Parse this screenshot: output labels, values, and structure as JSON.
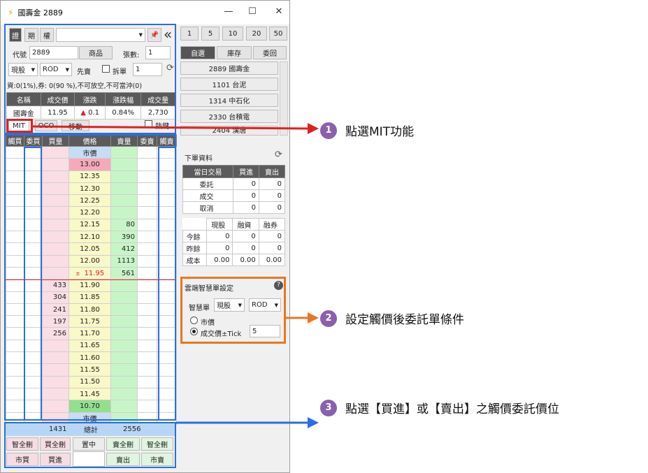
{
  "window": {
    "title": "國壽金 2889"
  },
  "top": {
    "tabs": [
      "證",
      "期",
      "權"
    ],
    "code_label": "代號",
    "code": "2889",
    "product_btn": "商品",
    "qty_label": "張數:",
    "qty": "1",
    "type": "現股",
    "cond": "ROD",
    "presell": "先賣",
    "split": "拆單",
    "split_qty": "1",
    "info": "資:0(1%),券: 0(90 %),不可放空,不可當沖(0)"
  },
  "quote": {
    "headers": [
      "名稱",
      "成交價",
      "漲跌",
      "漲跌幅",
      "成交量"
    ],
    "name": "國壽金",
    "price": "11.95",
    "change_icon": "▲",
    "change": "0.1",
    "pct": "0.84%",
    "vol": "2,730"
  },
  "modes": {
    "mit": "MIT",
    "oco": "OCO",
    "move": "移動",
    "hotkey": "熱鍵"
  },
  "ladder": {
    "headers": [
      "觸買",
      "委買",
      "買量",
      "價格",
      "賣量",
      "委賣",
      "觸賣"
    ],
    "rows": [
      {
        "bid": "",
        "price": "市價",
        "ask": "",
        "pc": "mkt"
      },
      {
        "bid": "",
        "price": "13.00",
        "ask": "",
        "pc": "lim"
      },
      {
        "bid": "",
        "price": "12.35",
        "ask": ""
      },
      {
        "bid": "",
        "price": "12.30",
        "ask": ""
      },
      {
        "bid": "",
        "price": "12.25",
        "ask": ""
      },
      {
        "bid": "",
        "price": "12.20",
        "ask": ""
      },
      {
        "bid": "",
        "price": "12.15",
        "ask": "80"
      },
      {
        "bid": "",
        "price": "12.10",
        "ask": "390"
      },
      {
        "bid": "",
        "price": "12.05",
        "ask": "412"
      },
      {
        "bid": "",
        "price": "12.00",
        "ask": "1113"
      },
      {
        "bid": "",
        "price": "11.95",
        "ask": "561",
        "pc": "last",
        "mark": "±"
      },
      {
        "bid": "433",
        "price": "11.90",
        "ask": ""
      },
      {
        "bid": "304",
        "price": "11.85",
        "ask": ""
      },
      {
        "bid": "241",
        "price": "11.80",
        "ask": ""
      },
      {
        "bid": "197",
        "price": "11.75",
        "ask": ""
      },
      {
        "bid": "256",
        "price": "11.70",
        "ask": ""
      },
      {
        "bid": "",
        "price": "11.65",
        "ask": ""
      },
      {
        "bid": "",
        "price": "11.60",
        "ask": ""
      },
      {
        "bid": "",
        "price": "11.55",
        "ask": ""
      },
      {
        "bid": "",
        "price": "11.50",
        "ask": ""
      },
      {
        "bid": "",
        "price": "11.45",
        "ask": ""
      },
      {
        "bid": "",
        "price": "10.70",
        "ask": "",
        "pc": "lim2"
      },
      {
        "bid": "",
        "price": "市價",
        "ask": "",
        "pc": "mkt"
      }
    ],
    "total_bid": "1431",
    "total_label": "總計",
    "total_ask": "2556"
  },
  "bottom": {
    "b1": "智全刪",
    "b2": "買全刪",
    "b3": "置中",
    "b4": "賣全刪",
    "b5": "智全刪",
    "b6": "市買",
    "b7": "買進",
    "b8": "賣出",
    "b9": "市賣"
  },
  "right": {
    "qtys": [
      "1",
      "5",
      "10",
      "20",
      "50"
    ],
    "tabs": [
      "自選",
      "庫存",
      "委回"
    ],
    "stocks": [
      "2889 國壽金",
      "1101 台泥",
      "1314 中石化",
      "2330 台積電",
      "2404 漢唐"
    ],
    "order_title": "下單資料",
    "ord_headers": [
      "當日交易",
      "買進",
      "賣出"
    ],
    "ord_rows": [
      {
        "l": "委託",
        "b": "0",
        "s": "0"
      },
      {
        "l": "成交",
        "b": "0",
        "s": "0"
      },
      {
        "l": "取消",
        "b": "0",
        "s": "0"
      }
    ],
    "pos_headers": [
      "現股",
      "融資",
      "融券"
    ],
    "pos_rows": [
      {
        "l": "今餘",
        "a": "0",
        "b": "0",
        "c": "0"
      },
      {
        "l": "昨餘",
        "a": "0",
        "b": "0",
        "c": "0"
      },
      {
        "l": "成本",
        "a": "0.00",
        "b": "0.00",
        "c": "0.00"
      }
    ],
    "smart_title": "雲端智慧單設定",
    "smart_label": "智慧單",
    "smart_type": "現股",
    "smart_cond": "ROD",
    "opt_market": "市價",
    "opt_tick": "成交價±Tick",
    "tick": "5"
  },
  "annotations": [
    "點選MIT功能",
    "設定觸價後委託單條件",
    "點選【買進】或【賣出】之觸價委託價位"
  ],
  "colors": {
    "red": "#e02020",
    "orange": "#e87820",
    "blue": "#2a6fe0",
    "purple": "#8a5fb0"
  }
}
